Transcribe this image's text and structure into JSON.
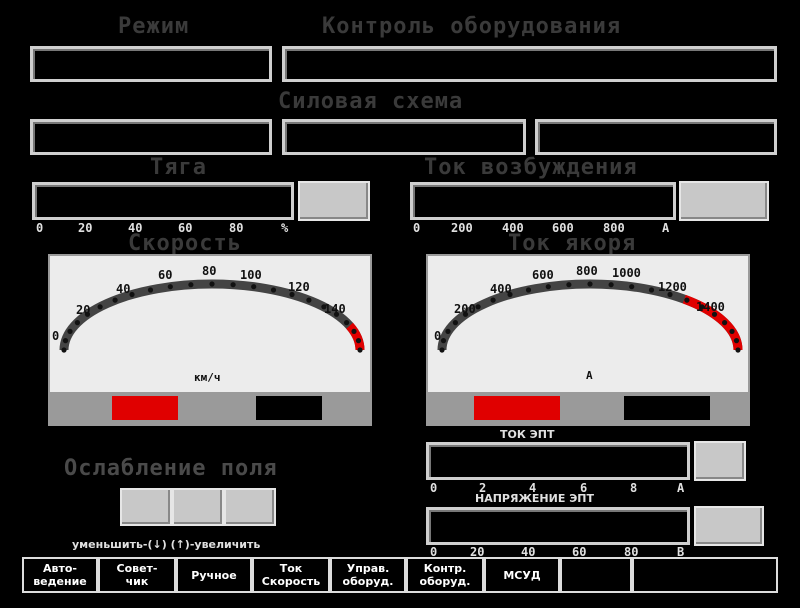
{
  "headers": {
    "mode": "Режим",
    "equipment_control": "Контроль оборудования",
    "power_circuit": "Силовая схема",
    "traction": "Тяга",
    "excitation_current": "Ток возбуждения",
    "speed": "Скорость",
    "armature_current": "Ток якоря",
    "field_weakening": "Ослабление поля"
  },
  "traction_scale": [
    "0",
    "20",
    "40",
    "60",
    "80",
    "%"
  ],
  "excitation_scale": [
    "0",
    "200",
    "400",
    "600",
    "800",
    "A"
  ],
  "speed_gauge": {
    "labels": [
      "0",
      "20",
      "40",
      "60",
      "80",
      "100",
      "120",
      "140"
    ],
    "unit": "км/ч",
    "red_from_fraction": 0.88,
    "indicator_colors": [
      "#e00000",
      "#000000"
    ]
  },
  "armature_gauge": {
    "labels": [
      "0",
      "200",
      "400",
      "600",
      "800",
      "1000",
      "1200",
      "1400"
    ],
    "unit": "A",
    "red_from_fraction": 0.72,
    "indicator_colors": [
      "#e00000",
      "#000000"
    ]
  },
  "ept_current": {
    "label": "ТОК ЭПТ",
    "scale": [
      "0",
      "2",
      "4",
      "6",
      "8",
      "A"
    ]
  },
  "ept_voltage": {
    "label": "НАПРЯЖЕНИЕ ЭПТ",
    "scale": [
      "0",
      "20",
      "40",
      "60",
      "80",
      "B"
    ]
  },
  "field_hint": "уменьшить-(↓) (↑)-увеличить",
  "menu": [
    "Авто-\nведение",
    "Совет-\nчик",
    "Ручное",
    "Ток\nСкорость",
    "Управ.\nоборуд.",
    "Контр.\nоборуд.",
    "МСУД",
    "",
    ""
  ],
  "colors": {
    "indicator_red": "#e00000",
    "gauge_face": "#ececec",
    "frame": "#cfcfcf"
  }
}
